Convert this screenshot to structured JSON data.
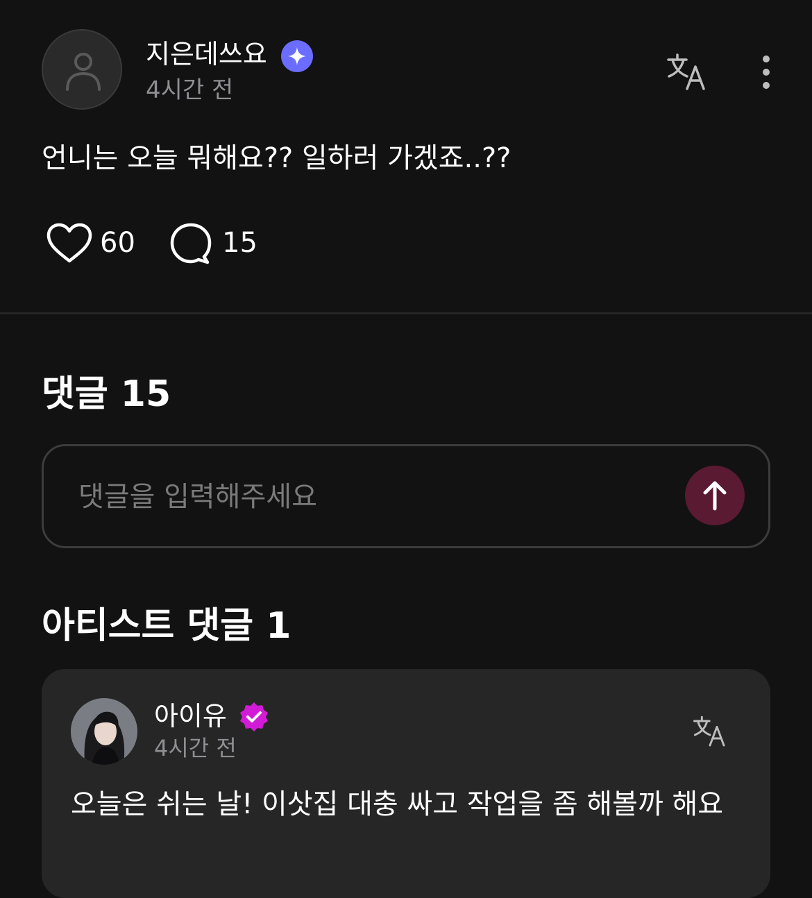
{
  "post": {
    "author": "지은데쓰요",
    "time": "4시간 전",
    "body": "언니는 오늘 뭐해요?? 일하러 가겠죠..??",
    "likes": "60",
    "comments": "15"
  },
  "comments_section": {
    "title": "댓글 15",
    "input_placeholder": "댓글을 입력해주세요"
  },
  "artist_section": {
    "title": "아티스트 댓글 1",
    "comment": {
      "author": "아이유",
      "time": "4시간 전",
      "body": "오늘은 쉬는 날! 이삿집 대충 싸고 작업을 좀 해볼까 해요"
    }
  },
  "icons": {
    "avatar": "default-user-icon",
    "badge": "sparkle-badge-icon",
    "translate": "translate-icon",
    "more": "more-vertical-icon",
    "like": "heart-icon",
    "comment": "comment-bubble-icon",
    "send": "arrow-up-icon",
    "artist_badge": "verified-badge-icon"
  },
  "colors": {
    "background": "#121212",
    "card": "#262626",
    "badge_blue": "#6a6dff",
    "badge_pink": "#d21bd6",
    "send_button": "#5a1a32",
    "muted_text": "#8e8e93"
  }
}
